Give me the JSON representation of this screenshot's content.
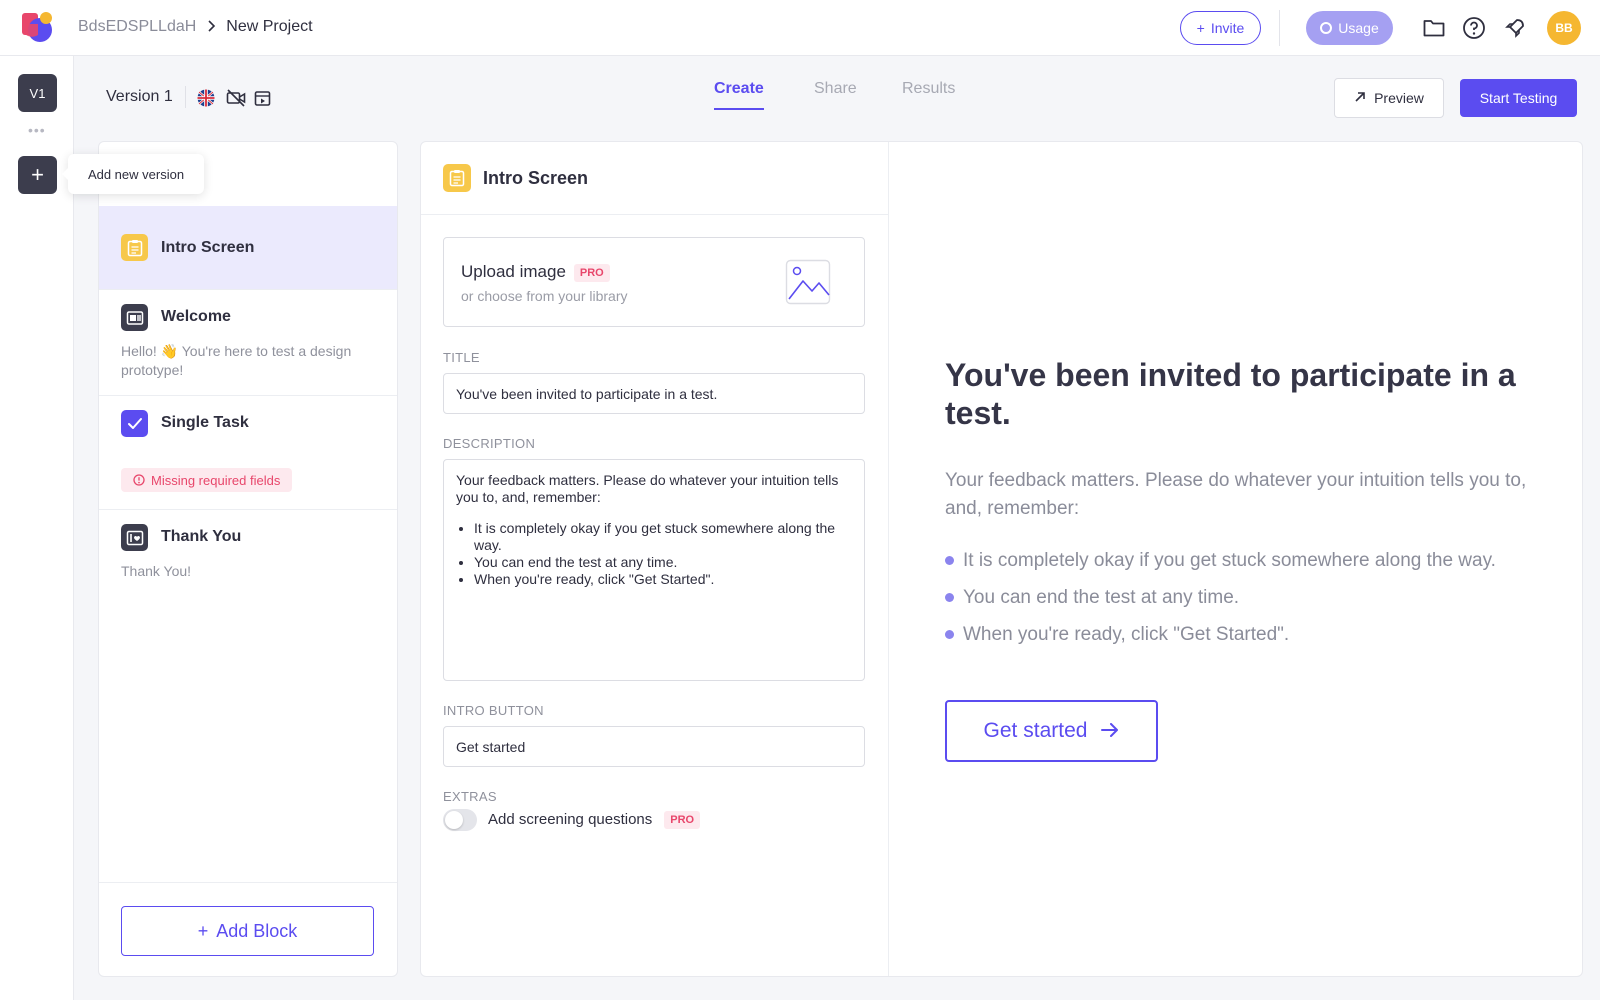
{
  "header": {
    "workspace": "BdsEDSPLLdaH",
    "project": "New Project",
    "invite_label": "Invite",
    "usage_label": "Usage",
    "avatar_initials": "BB"
  },
  "rail": {
    "version_badge": "V1",
    "dots": "•••",
    "add_version_tooltip": "Add new version"
  },
  "version": {
    "label": "Version 1"
  },
  "tabs": [
    {
      "label": "Create",
      "active": true
    },
    {
      "label": "Share",
      "active": false
    },
    {
      "label": "Results",
      "active": false
    }
  ],
  "actions": {
    "preview_label": "Preview",
    "start_label": "Start Testing"
  },
  "blocks": [
    {
      "title": "Intro Screen",
      "description": "",
      "icon": "clipboard-icon",
      "color": "#f7c84a",
      "selected": true
    },
    {
      "title": "Welcome",
      "description": "Hello! 👋 You're here to test a design prototype!",
      "icon": "welcome-icon",
      "color": "#3c3d4d",
      "selected": false
    },
    {
      "title": "Single Task",
      "description": "",
      "icon": "checkbox-icon",
      "color": "#5b4cf0",
      "selected": false,
      "warning": "Missing required fields"
    },
    {
      "title": "Thank You",
      "description": "Thank You!",
      "icon": "thank-you-icon",
      "color": "#3c3d4d",
      "selected": false
    }
  ],
  "add_block_label": "Add Block",
  "editor": {
    "title": "Intro Screen",
    "upload_title": "Upload image",
    "pro_label": "PRO",
    "upload_sub": "or choose from your library",
    "title_label": "TITLE",
    "title_value": "You've been invited to participate in a test.",
    "description_label": "DESCRIPTION",
    "description_intro": "Your feedback matters. Please do whatever your intuition tells you to, and, remember:",
    "description_items": [
      "It is completely okay if you get stuck somewhere along the way.",
      "You can end the test at any time.",
      "When you're ready, click \"Get Started\"."
    ],
    "button_label": "INTRO BUTTON",
    "button_value": "Get started",
    "extras_label": "EXTRAS",
    "screening_label": "Add screening questions"
  },
  "preview": {
    "title": "You've been invited to participate in a test.",
    "description": "Your feedback matters. Please do whatever your intuition tells you to, and, remember:",
    "items": [
      "It is completely okay if you get stuck somewhere along the way.",
      "You can end the test at any time.",
      "When you're ready, click \"Get Started\"."
    ],
    "button": "Get started"
  },
  "colors": {
    "accent": "#5b4cf0",
    "warning": "#e8466b",
    "avatar": "#f5b731"
  }
}
